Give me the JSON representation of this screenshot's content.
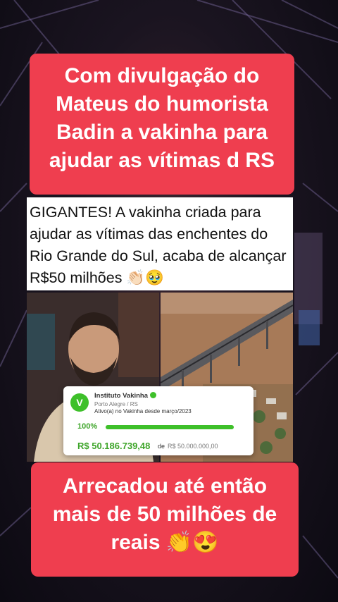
{
  "header_banner": {
    "text": "Com divulgação do Mateus do humorista Badin a vakinha para ajudar as vítimas d RS"
  },
  "news_post": {
    "text": "GIGANTES! A vakinha criada para ajudar as vítimas das enchentes do Rio Grande do Sul, acaba de alcançar R$50 milhões 👏🏻🥹"
  },
  "donation_card": {
    "logo_letter": "V",
    "org_name": "Instituto Vakinha",
    "location": "Porto Alegre / RS",
    "active_since": "Ativo(a) no Vakinha desde março/2023",
    "progress_label": "100%",
    "progress_fraction": 1.0,
    "raised": "R$ 50.186.739,48",
    "of_label": "de",
    "goal": "R$ 50.000.000,00",
    "accent_color": "#3ec02a"
  },
  "footer_banner": {
    "text": "Arrecadou até então mais de 50 milhões de reais 👏😍"
  },
  "colors": {
    "banner": "#ef3e4f",
    "background": "#1a1420"
  }
}
